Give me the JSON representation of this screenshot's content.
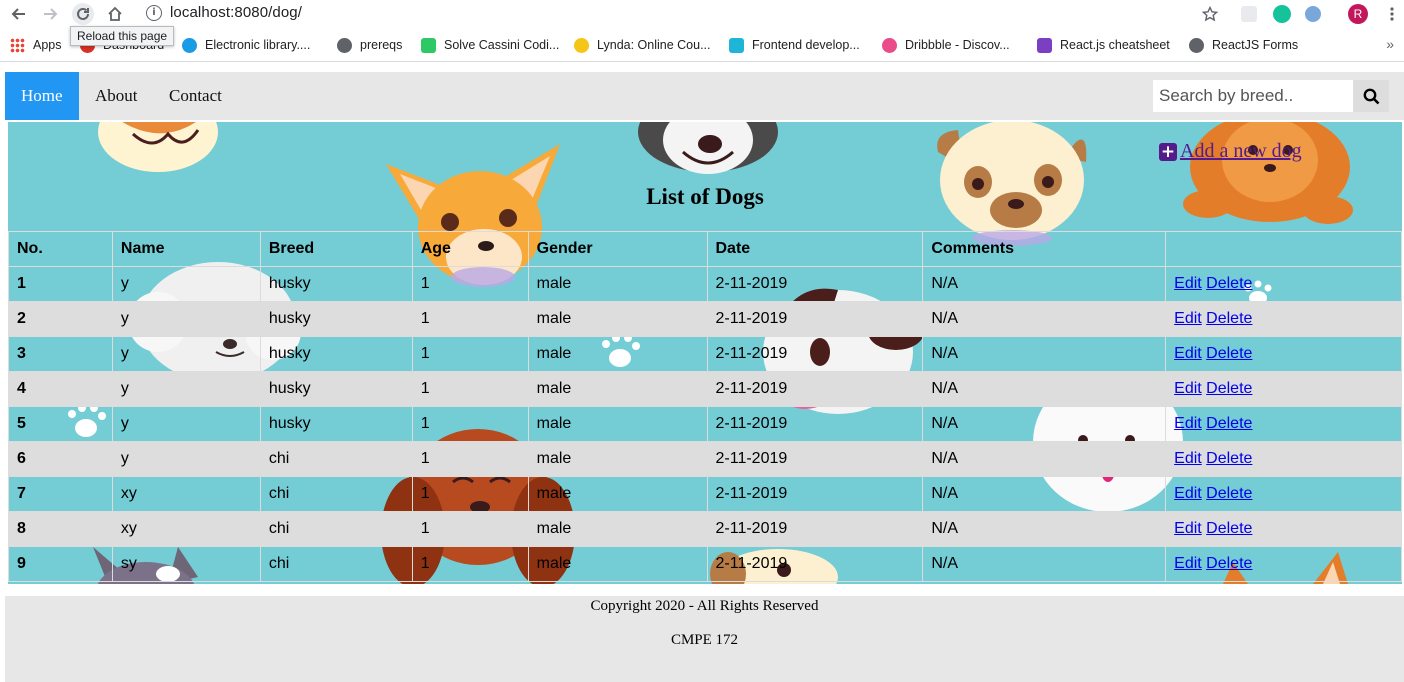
{
  "browser": {
    "url_host": "localhost",
    "url_path": ":8080/dog/",
    "tooltip": "Reload this page",
    "profile_initial": "R",
    "bookmarks": [
      {
        "label": "Apps",
        "color": "#ea4335"
      },
      {
        "label": "Dashboard",
        "color": "#d93025"
      },
      {
        "label": "Electronic library....",
        "color": "#1a9be6"
      },
      {
        "label": "prereqs",
        "color": "#5f6368"
      },
      {
        "label": "Solve Cassini Codi...",
        "color": "#2ec866"
      },
      {
        "label": "Lynda: Online Cou...",
        "color": "#f5c518"
      },
      {
        "label": "Frontend develop...",
        "color": "#1fb5d8"
      },
      {
        "label": "Dribbble - Discov...",
        "color": "#ea4c89"
      },
      {
        "label": "React.js cheatsheet",
        "color": "#7b3fc4"
      },
      {
        "label": "ReactJS Forms",
        "color": "#5f6368"
      }
    ]
  },
  "nav": {
    "items": [
      {
        "label": "Home",
        "active": true
      },
      {
        "label": "About",
        "active": false
      },
      {
        "label": "Contact",
        "active": false
      }
    ],
    "search_placeholder": "Search by breed.."
  },
  "main": {
    "add_link": "Add a new dog",
    "title": "List of Dogs",
    "table": {
      "headers": [
        "No.",
        "Name",
        "Breed",
        "Age",
        "Gender",
        "Date",
        "Comments",
        ""
      ],
      "edit_label": "Edit",
      "delete_label": "Delete",
      "rows": [
        [
          "1",
          "y",
          "husky",
          "1",
          "male",
          "2-11-2019",
          "N/A"
        ],
        [
          "2",
          "y",
          "husky",
          "1",
          "male",
          "2-11-2019",
          "N/A"
        ],
        [
          "3",
          "y",
          "husky",
          "1",
          "male",
          "2-11-2019",
          "N/A"
        ],
        [
          "4",
          "y",
          "husky",
          "1",
          "male",
          "2-11-2019",
          "N/A"
        ],
        [
          "5",
          "y",
          "husky",
          "1",
          "male",
          "2-11-2019",
          "N/A"
        ],
        [
          "6",
          "y",
          "chi",
          "1",
          "male",
          "2-11-2019",
          "N/A"
        ],
        [
          "7",
          "xy",
          "chi",
          "1",
          "male",
          "2-11-2019",
          "N/A"
        ],
        [
          "8",
          "xy",
          "chi",
          "1",
          "male",
          "2-11-2019",
          "N/A"
        ],
        [
          "9",
          "sy",
          "chi",
          "1",
          "male",
          "2-11-2019",
          "N/A"
        ]
      ]
    }
  },
  "footer": {
    "copyright": "Copyright 2020 - All Rights Reserved",
    "course": "CMPE 172"
  },
  "colors": {
    "nav_active": "#2196F3",
    "content_bg": "#74cdd5",
    "row_alt": "#dddddd",
    "link": "#0000ee",
    "visited_link": "#551a8b"
  }
}
